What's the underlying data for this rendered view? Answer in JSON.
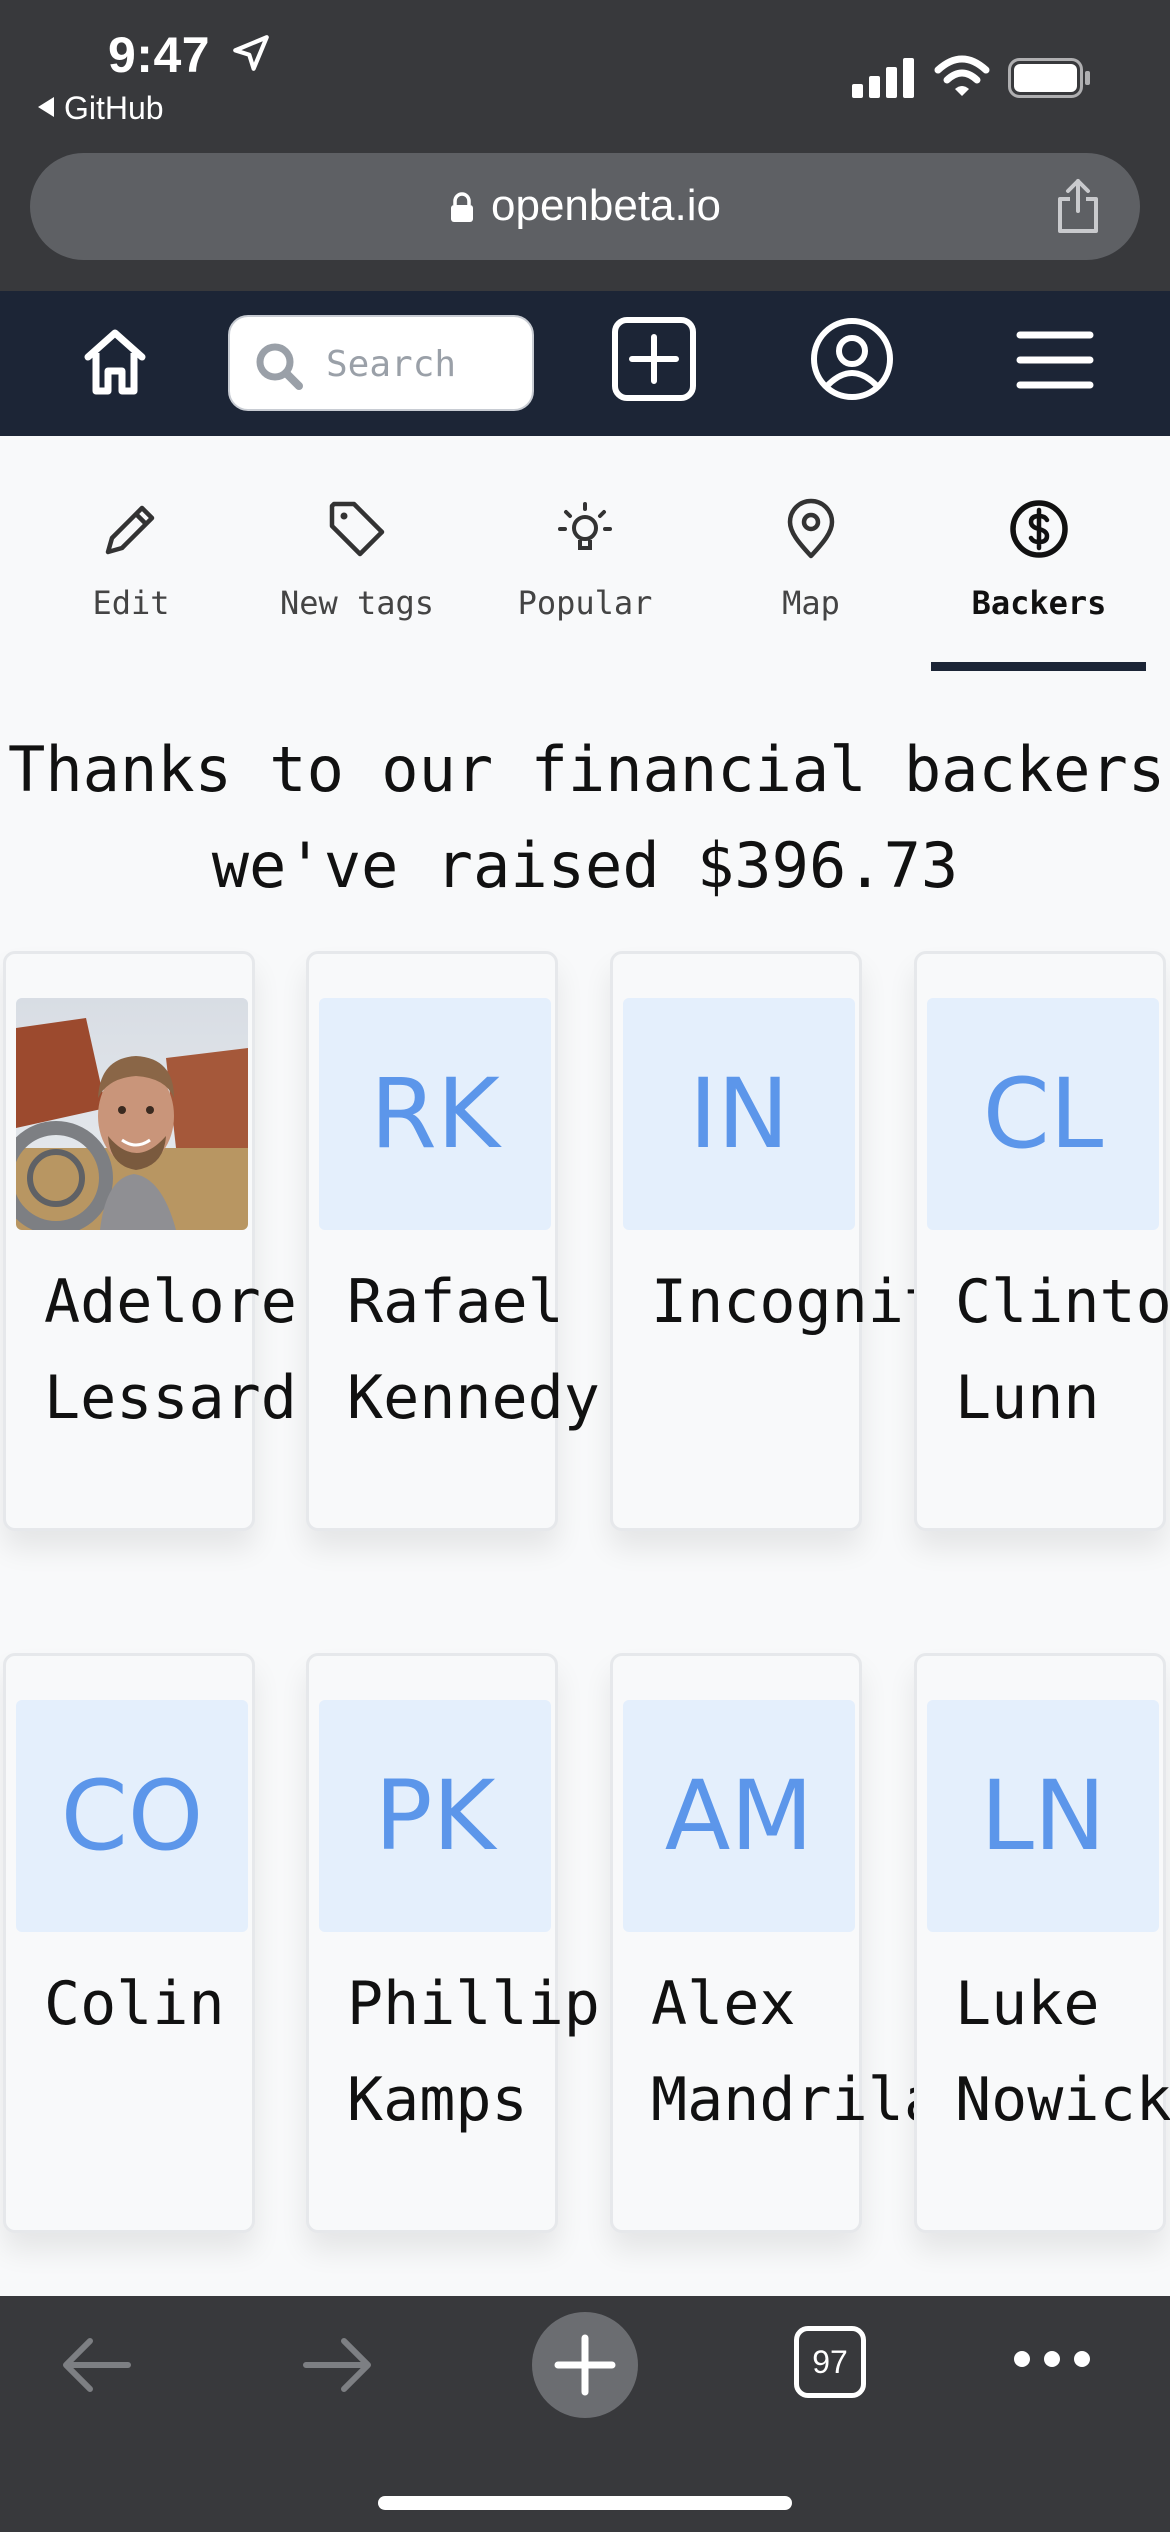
{
  "status_bar": {
    "time": "9:47",
    "back_app": "GitHub"
  },
  "browser": {
    "url": "openbeta.io",
    "tabs_count": "97"
  },
  "header": {
    "search_placeholder": "Search"
  },
  "tabs": [
    {
      "label": "Edit",
      "icon": "pencil-icon"
    },
    {
      "label": "New tags",
      "icon": "tag-icon"
    },
    {
      "label": "Popular",
      "icon": "lightbulb-icon"
    },
    {
      "label": "Map",
      "icon": "map-pin-icon"
    },
    {
      "label": "Backers",
      "icon": "dollar-circle-icon",
      "active": true
    }
  ],
  "heading": {
    "line1": "Thanks to our financial backers",
    "line2": "we've raised $396.73"
  },
  "backers": [
    {
      "initials": "",
      "name": "Adelore\nLessard",
      "has_photo": true
    },
    {
      "initials": "RK",
      "name": "Rafael\nKennedy"
    },
    {
      "initials": "IN",
      "name": "Incognito"
    },
    {
      "initials": "CL",
      "name": "Clinton\nLunn"
    },
    {
      "initials": "CO",
      "name": "Colin"
    },
    {
      "initials": "PK",
      "name": "Phillip\nKamps"
    },
    {
      "initials": "AM",
      "name": "Alex\nMandrila"
    },
    {
      "initials": "LN",
      "name": "Luke\nNowicki"
    }
  ],
  "colors": {
    "nav_bg": "#1c2536",
    "browser_chrome": "#38393c",
    "avatar_bg": "#e4effc",
    "avatar_text": "#5c96ea"
  }
}
